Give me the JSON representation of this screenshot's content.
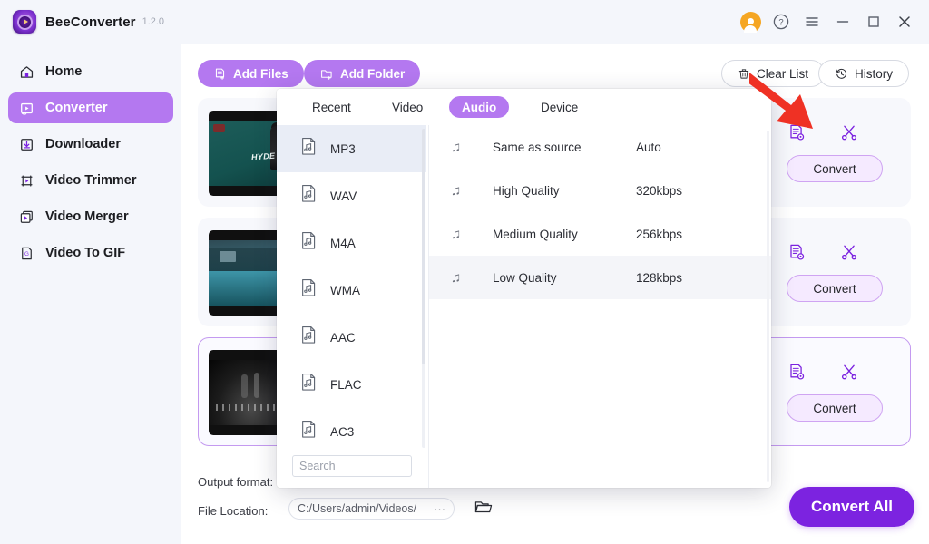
{
  "window": {
    "app_title": "BeeConverter",
    "version": "1.2.0",
    "controls": {
      "account": "account-avatar",
      "help": "?",
      "menu": "menu-icon",
      "minimize": "minimize-icon",
      "maximize": "maximize-icon",
      "close": "close-icon"
    }
  },
  "sidebar": {
    "items": [
      {
        "label": "Home",
        "icon": "home-icon",
        "active": false
      },
      {
        "label": "Converter",
        "icon": "converter-icon",
        "active": true
      },
      {
        "label": "Downloader",
        "icon": "download-icon",
        "active": false
      },
      {
        "label": "Video Trimmer",
        "icon": "trim-icon",
        "active": false
      },
      {
        "label": "Video Merger",
        "icon": "merge-icon",
        "active": false
      },
      {
        "label": "Video To GIF",
        "icon": "gif-icon",
        "active": false
      }
    ]
  },
  "toolbar": {
    "add_files": "Add Files",
    "add_folder": "Add Folder",
    "clear_list": "Clear List",
    "history": "History",
    "icons": {
      "add_files": "file-plus-icon",
      "add_folder": "folder-plus-icon",
      "clear_list": "trash-icon",
      "history": "clock-history-icon"
    }
  },
  "file_rows": [
    {
      "convert_label": "Convert",
      "selected": false,
      "thumb": "hyde-me-thumbnail"
    },
    {
      "convert_label": "Convert",
      "selected": false,
      "thumb": "coastal-town-thumbnail"
    },
    {
      "convert_label": "Convert",
      "selected": true,
      "thumb": "night-crowd-thumbnail"
    }
  ],
  "row_icons": {
    "settings": "file-settings-icon",
    "cut": "scissors-icon"
  },
  "format_panel": {
    "tabs": [
      {
        "label": "Recent",
        "active": false
      },
      {
        "label": "Video",
        "active": false
      },
      {
        "label": "Audio",
        "active": true
      },
      {
        "label": "Device",
        "active": false
      }
    ],
    "formats": [
      {
        "label": "MP3",
        "active": true
      },
      {
        "label": "WAV",
        "active": false
      },
      {
        "label": "M4A",
        "active": false
      },
      {
        "label": "WMA",
        "active": false
      },
      {
        "label": "AAC",
        "active": false
      },
      {
        "label": "FLAC",
        "active": false
      },
      {
        "label": "AC3",
        "active": false
      }
    ],
    "search_placeholder": "Search",
    "search_value": "",
    "qualities": [
      {
        "name": "Same as source",
        "rate": "Auto",
        "active": false
      },
      {
        "name": "High Quality",
        "rate": "320kbps",
        "active": false
      },
      {
        "name": "Medium Quality",
        "rate": "256kbps",
        "active": false
      },
      {
        "name": "Low Quality",
        "rate": "128kbps",
        "active": true
      }
    ]
  },
  "bottom": {
    "output_format_label": "Output format:",
    "file_location_label": "File Location:",
    "file_location_path": "C:/Users/admin/Videos/",
    "path_more": "···",
    "folder_icon": "folder-open-icon",
    "convert_all": "Convert All"
  },
  "annotation": {
    "type": "red-arrow",
    "color": "#ef3124",
    "points_to": "file-settings-icon"
  },
  "colors": {
    "accent": "#b478f0",
    "accent_strong": "#7c23e0",
    "sidebar_bg": "#f4f6fb",
    "row_bg": "#f7f8fc",
    "selected_border": "#c49af0",
    "annotation_red": "#ef3124",
    "avatar_orange": "#f5a623"
  }
}
